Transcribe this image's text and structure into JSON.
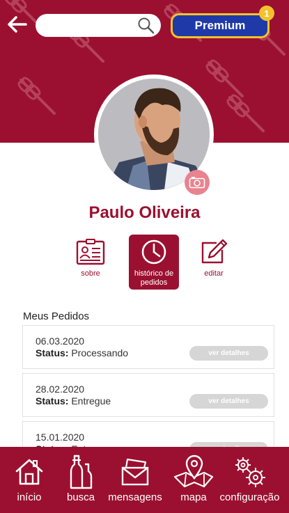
{
  "header": {
    "search_placeholder": "",
    "premium_label": "Premium",
    "premium_badge": "1"
  },
  "profile": {
    "name": "Paulo Oliveira"
  },
  "tabs": [
    {
      "label": "sobre",
      "icon": "id-card-icon"
    },
    {
      "label": "histórico de pedidos",
      "icon": "clock-icon",
      "active": true
    },
    {
      "label": "editar",
      "icon": "edit-icon"
    }
  ],
  "orders": {
    "title": "Meus Pedidos",
    "status_label": "Status:",
    "details_label": "ver detalhes",
    "items": [
      {
        "date": "06.03.2020",
        "status": "Processando"
      },
      {
        "date": "28.02.2020",
        "status": "Entregue"
      },
      {
        "date": "15.01.2020",
        "status": "Entregue"
      }
    ]
  },
  "nav": [
    {
      "label": "início",
      "icon": "home-icon"
    },
    {
      "label": "busca",
      "icon": "bottles-icon"
    },
    {
      "label": "mensagens",
      "icon": "envelope-icon"
    },
    {
      "label": "mapa",
      "icon": "map-pin-icon"
    },
    {
      "label": "configuração",
      "icon": "gears-icon"
    }
  ],
  "colors": {
    "primary": "#9b1030",
    "premium": "#1f3aa8",
    "gold": "#f3c12d"
  }
}
